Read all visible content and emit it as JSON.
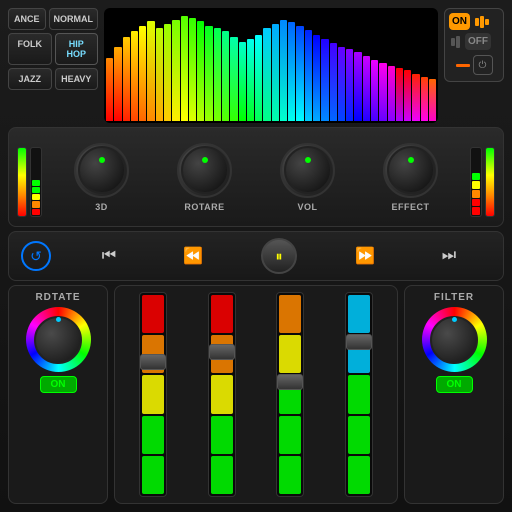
{
  "genre": {
    "buttons": [
      {
        "id": "ance",
        "label": "ANCE",
        "active": false
      },
      {
        "id": "normal",
        "label": "NORMAL",
        "active": false
      },
      {
        "id": "folk",
        "label": "FOLK",
        "active": false
      },
      {
        "id": "hiphop",
        "label": "HIP HOP",
        "active": true
      },
      {
        "id": "jazz",
        "label": "JAZZ",
        "active": false
      },
      {
        "id": "heavy",
        "label": "HEAVY",
        "active": false
      }
    ]
  },
  "controls": {
    "on_label": "ON",
    "off_label": "OFF"
  },
  "knobs": [
    {
      "id": "3d",
      "label": "3D"
    },
    {
      "id": "rotare",
      "label": "ROTARE"
    },
    {
      "id": "vol",
      "label": "VOL"
    },
    {
      "id": "effect",
      "label": "EFFECT"
    }
  ],
  "transport": {
    "buttons": [
      "⟳",
      "⏮",
      "⏪",
      "⏸",
      "⏩",
      "⏭"
    ]
  },
  "bottom": {
    "rotate_label": "RDTATE",
    "filter_label": "FILTER",
    "on_label": "ON",
    "faders": [
      {
        "id": "f1",
        "colors": [
          "#f00",
          "#f80",
          "#ff0",
          "#0f0",
          "#0f0"
        ]
      },
      {
        "id": "f2",
        "colors": [
          "#f00",
          "#f80",
          "#ff0",
          "#0f0",
          "#0f0"
        ]
      },
      {
        "id": "f3",
        "colors": [
          "#ff0",
          "#ff0",
          "#0f0",
          "#0f0",
          "#0f0"
        ]
      },
      {
        "id": "f4",
        "colors": [
          "#0cf",
          "#0cf",
          "#0f0",
          "#0f0",
          "#0f0"
        ]
      }
    ]
  },
  "spectrum_colors": [
    "#f00",
    "#f00",
    "#f20",
    "#f40",
    "#f60",
    "#f80",
    "#fa0",
    "#fc0",
    "#fe0",
    "#ff0",
    "#df0",
    "#bf0",
    "#9f0",
    "#7f0",
    "#5f0",
    "#3f0",
    "#0f0",
    "#0f2",
    "#0f5",
    "#0f8",
    "#0fa",
    "#0fc",
    "#0fe",
    "#0ff",
    "#0cf",
    "#0af",
    "#08f",
    "#06f",
    "#04f",
    "#02f",
    "#00f",
    "#20f",
    "#40f",
    "#60f",
    "#80f",
    "#a0f",
    "#c0f",
    "#e0f",
    "#f0e",
    "#f0c"
  ],
  "spectrum_heights": [
    60,
    70,
    80,
    85,
    90,
    95,
    88,
    92,
    96,
    100,
    98,
    95,
    90,
    88,
    85,
    80,
    75,
    78,
    82,
    88,
    92,
    96,
    94,
    90,
    86,
    82,
    78,
    74,
    70,
    68,
    65,
    62,
    58,
    55,
    52,
    50,
    48,
    45,
    42,
    40
  ]
}
